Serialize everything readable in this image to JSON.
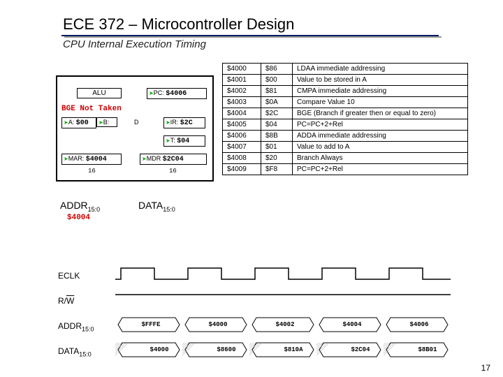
{
  "title": "ECE 372 – Microcontroller Design",
  "subtitle": "CPU Internal Execution Timing",
  "page_number": "17",
  "cpu": {
    "alu_label": "ALU",
    "bge_text": "BGE Not Taken",
    "pc": {
      "label": "PC:",
      "value": "$4006"
    },
    "a": {
      "label": "A:",
      "value": "$00"
    },
    "b": {
      "label": "B:",
      "value": ""
    },
    "d": {
      "label": "D",
      "value": ""
    },
    "ir": {
      "label": "IR:",
      "value": "$2C"
    },
    "t": {
      "label": "T:",
      "value": "$04"
    },
    "mar": {
      "label": "MAR:",
      "value": "$4004"
    },
    "mdr": {
      "label": "MDR",
      "value": "$2C04"
    },
    "bus_width": "16"
  },
  "addr_label": "ADDR",
  "addr_sub": "15:0",
  "addr_value": "$4004",
  "data_label": "DATA",
  "data_sub": "15:0",
  "memory": [
    {
      "addr": "$4000",
      "val": "$86",
      "desc": "LDAA immediate addressing"
    },
    {
      "addr": "$4001",
      "val": "$00",
      "desc": "Value to be stored in A"
    },
    {
      "addr": "$4002",
      "val": "$81",
      "desc": "CMPA immediate addressing"
    },
    {
      "addr": "$4003",
      "val": "$0A",
      "desc": "Compare Value 10"
    },
    {
      "addr": "$4004",
      "val": "$2C",
      "desc": "BGE (Branch if greater then or equal to zero)"
    },
    {
      "addr": "$4005",
      "val": "$04",
      "desc": "PC=PC+2+Rel"
    },
    {
      "addr": "$4006",
      "val": "$8B",
      "desc": "ADDA immediate addressing"
    },
    {
      "addr": "$4007",
      "val": "$01",
      "desc": "Value to add to A"
    },
    {
      "addr": "$4008",
      "val": "$20",
      "desc": "Branch Always"
    },
    {
      "addr": "$4009",
      "val": "$F8",
      "desc": "PC=PC+2+Rel"
    }
  ],
  "timing": {
    "rows": {
      "eclk": "ECLK",
      "rw": "R/",
      "rw_over": "W",
      "addr": "ADDR",
      "data": "DATA"
    },
    "addr_values": [
      "$FFFE",
      "$4000",
      "$4002",
      "$4004",
      "$4006"
    ],
    "data_values": [
      "$4000",
      "$8600",
      "$810A",
      "$2C04",
      "$8B01"
    ]
  }
}
